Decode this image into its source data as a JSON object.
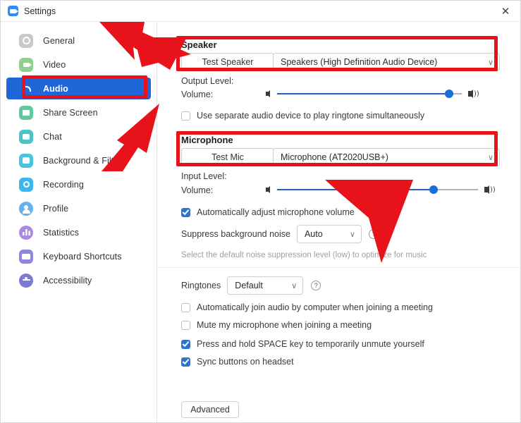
{
  "window": {
    "title": "Settings",
    "app_icon": "zoom-camera-icon",
    "close_label": "✕"
  },
  "sidebar": {
    "items": [
      {
        "label": "General",
        "icon": "gear-icon",
        "active": false
      },
      {
        "label": "Video",
        "icon": "video-camera-icon",
        "active": false
      },
      {
        "label": "Audio",
        "icon": "headphones-icon",
        "active": true
      },
      {
        "label": "Share Screen",
        "icon": "share-screen-icon",
        "active": false
      },
      {
        "label": "Chat",
        "icon": "chat-bubble-icon",
        "active": false
      },
      {
        "label": "Background & Filters",
        "icon": "background-filters-icon",
        "active": false
      },
      {
        "label": "Recording",
        "icon": "recording-icon",
        "active": false
      },
      {
        "label": "Profile",
        "icon": "profile-person-icon",
        "active": false
      },
      {
        "label": "Statistics",
        "icon": "statistics-bars-icon",
        "active": false
      },
      {
        "label": "Keyboard Shortcuts",
        "icon": "keyboard-icon",
        "active": false
      },
      {
        "label": "Accessibility",
        "icon": "accessibility-icon",
        "active": false
      }
    ]
  },
  "speaker": {
    "heading": "Speaker",
    "test_button": "Test Speaker",
    "device": "Speakers (High Definition Audio Device)",
    "chevron": "∨",
    "output_level_label": "Output Level:",
    "volume_label": "Volume:",
    "volume_percent": 93,
    "separate_device_checkbox": {
      "label": "Use separate audio device to play ringtone simultaneously",
      "checked": false
    }
  },
  "microphone": {
    "heading": "Microphone",
    "test_button": "Test Mic",
    "device": "Microphone (AT2020USB+)",
    "chevron": "∨",
    "input_level_label": "Input Level:",
    "volume_label": "Volume:",
    "volume_percent": 78,
    "auto_adjust_checkbox": {
      "label": "Automatically adjust microphone volume",
      "checked": true
    },
    "suppress_noise": {
      "label": "Suppress background noise",
      "value": "Auto",
      "chevron": "∨",
      "help": "?",
      "hint": "Select the default noise suppression level (low) to optimize for music"
    }
  },
  "ringtones": {
    "label": "Ringtones",
    "value": "Default",
    "chevron": "∨",
    "help": "?"
  },
  "options": [
    {
      "label": "Automatically join audio by computer when joining a meeting",
      "checked": false
    },
    {
      "label": "Mute my microphone when joining a meeting",
      "checked": false
    },
    {
      "label": "Press and hold SPACE key to temporarily unmute yourself",
      "checked": true
    },
    {
      "label": "Sync buttons on headset",
      "checked": true
    }
  ],
  "footer": {
    "advanced_button": "Advanced"
  },
  "annotations": {
    "highlight_color": "#e8131a",
    "arrow_color": "#e8131a",
    "boxes": [
      {
        "name": "audio-sidebar-highlight"
      },
      {
        "name": "speaker-section-highlight"
      },
      {
        "name": "microphone-section-highlight"
      }
    ],
    "arrows": [
      {
        "name": "arrow-to-speaker-section"
      },
      {
        "name": "arrow-to-audio-tab"
      },
      {
        "name": "arrow-to-microphone-volume"
      }
    ]
  },
  "colors": {
    "accent_blue": "#1f66d9",
    "slider_blue": "#1a6fd4",
    "checkbox_blue": "#2d73d2",
    "annotation_red": "#e8131a"
  }
}
